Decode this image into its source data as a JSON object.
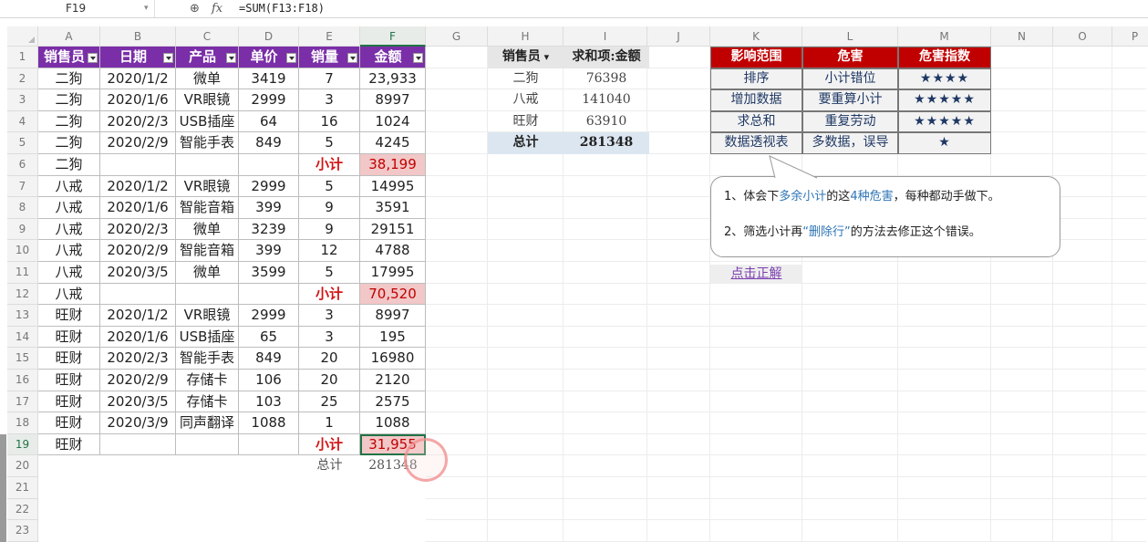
{
  "formula_bar": {
    "name_box": "F19",
    "fx_label": "fx",
    "formula": "=SUM(F13:F18)"
  },
  "columns": [
    "A",
    "B",
    "C",
    "D",
    "E",
    "F",
    "G",
    "H",
    "I",
    "J",
    "K",
    "L",
    "M",
    "N",
    "O",
    "P"
  ],
  "rows": [
    "1",
    "2",
    "3",
    "4",
    "5",
    "6",
    "7",
    "8",
    "9",
    "10",
    "11",
    "12",
    "13",
    "14",
    "15",
    "16",
    "17",
    "18",
    "19",
    "20",
    "21",
    "22",
    "23"
  ],
  "table": {
    "headers": [
      "销售员",
      "日期",
      "产品",
      "单价",
      "销量",
      "金额"
    ],
    "data": [
      [
        "二狗",
        "2020/1/2",
        "微单",
        "3419",
        "7",
        "23,933"
      ],
      [
        "二狗",
        "2020/1/6",
        "VR眼镜",
        "2999",
        "3",
        "8997"
      ],
      [
        "二狗",
        "2020/2/3",
        "USB插座",
        "64",
        "16",
        "1024"
      ],
      [
        "二狗",
        "2020/2/9",
        "智能手表",
        "849",
        "5",
        "4245"
      ],
      [
        "二狗",
        "",
        "",
        "",
        "小计",
        "38,199"
      ],
      [
        "八戒",
        "2020/1/2",
        "VR眼镜",
        "2999",
        "5",
        "14995"
      ],
      [
        "八戒",
        "2020/1/6",
        "智能音箱",
        "399",
        "9",
        "3591"
      ],
      [
        "八戒",
        "2020/2/3",
        "微单",
        "3239",
        "9",
        "29151"
      ],
      [
        "八戒",
        "2020/2/9",
        "智能音箱",
        "399",
        "12",
        "4788"
      ],
      [
        "八戒",
        "2020/3/5",
        "微单",
        "3599",
        "5",
        "17995"
      ],
      [
        "八戒",
        "",
        "",
        "",
        "小计",
        "70,520"
      ],
      [
        "旺财",
        "2020/1/2",
        "VR眼镜",
        "2999",
        "3",
        "8997"
      ],
      [
        "旺财",
        "2020/1/6",
        "USB插座",
        "65",
        "3",
        "195"
      ],
      [
        "旺财",
        "2020/2/3",
        "智能手表",
        "849",
        "20",
        "16980"
      ],
      [
        "旺财",
        "2020/2/9",
        "存储卡",
        "106",
        "20",
        "2120"
      ],
      [
        "旺财",
        "2020/3/5",
        "存储卡",
        "103",
        "25",
        "2575"
      ],
      [
        "旺财",
        "2020/3/9",
        "同声翻译",
        "1088",
        "1",
        "1088"
      ],
      [
        "旺财",
        "",
        "",
        "",
        "小计",
        "31,955"
      ]
    ],
    "total_label": "总计",
    "total_value": "281348"
  },
  "pivot": {
    "header_row": "销售员",
    "header_value": "求和项:金额",
    "rows": [
      [
        "二狗",
        "76398"
      ],
      [
        "八戒",
        "141040"
      ],
      [
        "旺财",
        "63910"
      ]
    ],
    "total_label": "总计",
    "total_value": "281348"
  },
  "harm_table": {
    "headers": [
      "影响范围",
      "危害",
      "危害指数"
    ],
    "rows": [
      [
        "排序",
        "小计错位",
        "★★★★"
      ],
      [
        "增加数据",
        "要重算小计",
        "★★★★★"
      ],
      [
        "求总和",
        "重复劳动",
        "★★★★★"
      ],
      [
        "数据透视表",
        "多数据，误导",
        "★"
      ]
    ]
  },
  "callout": {
    "line1": {
      "a": "1、体会下",
      "b": "多余小计",
      "c": "的这",
      "d": "4种危害",
      "e": "，每种都动手做下。"
    },
    "line2": {
      "a": "2、筛选小计再",
      "b": "“删除行”",
      "c": "的方法去修正这个错误。"
    }
  },
  "link_text": "点击正解",
  "colors": {
    "table_header": "#7a2ea8",
    "harm_header": "#c00000",
    "subtotal_red": "#d21414",
    "excel_green": "#217346"
  }
}
